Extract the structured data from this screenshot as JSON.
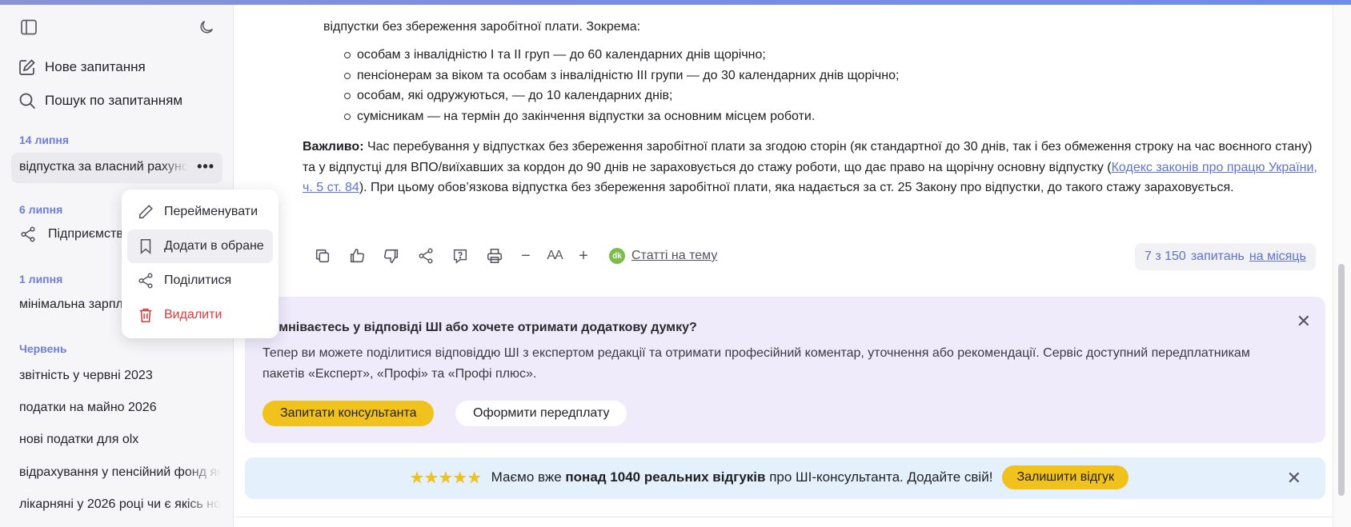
{
  "sidebar": {
    "new_request": "Нове запитання",
    "search": "Пошук по запитанням",
    "groups": [
      {
        "label": "14 липня",
        "items": [
          "відпустка за власний рахунок"
        ]
      },
      {
        "label": "6 липня",
        "items": [
          "Підприємство"
        ]
      },
      {
        "label": "1 липня",
        "items": [
          "мінімальна зарплата"
        ]
      },
      {
        "label": "Червень",
        "items": [
          "звітність у червні 2023",
          "податки на майно 2026",
          "нові податки для olx",
          "відрахування у пенсійний фонд як",
          "лікарняні у 2026 році чи є якісь но"
        ]
      }
    ],
    "more_glyph": "•••"
  },
  "context_menu": {
    "items": [
      {
        "label": "Перейменувати",
        "icon": "pencil-icon"
      },
      {
        "label": "Додати в обране",
        "icon": "bookmark-icon"
      },
      {
        "label": "Поділитися",
        "icon": "share-icon"
      },
      {
        "label": "Видалити",
        "icon": "trash-icon"
      }
    ]
  },
  "content": {
    "top_line": "відпустки без збереження заробітної плати. Зокрема:",
    "bullets": [
      "особам з інвалідністю I та II груп — до 60 календарних днів щорічно;",
      "пенсіонерам за віком та особам з інвалідністю III групи — до 30 календарних днів щорічно;",
      "особам, які одружуються, — до 10 календарних днів;",
      "сумісникам — на термін до закінчення відпустки за основним місцем роботи."
    ],
    "important_label": "Важливо:",
    "important_text": " Час перебування у відпустках без збереження заробітної плати за згодою сторін (як стандартної до 30 днів, так і без обмеження строку на час воєнного стану) та у відпустці для ВПО/виїхавших за кордон до 90 днів не зараховується до стажу роботи, що дає право на щорічну основну відпустку (",
    "important_link": "Кодекс законів про працю України, ч. 5 ст. 84",
    "important_tail": "). При цьому обов’язкова відпустка без збереження заробітної плати, яка надається за ст. 25 Закону про відпустки, до такого стажу зараховується."
  },
  "toolbar": {
    "icons": [
      "copy-icon",
      "thumbs-up-icon",
      "thumbs-down-icon",
      "share-icon",
      "help-icon",
      "print-icon",
      "font-decrease-icon",
      "font-size-icon",
      "font-increase-icon"
    ],
    "minus": "−",
    "aa": "AA",
    "plus": "+",
    "dk_badge": "dk",
    "articles": "Статті на тему",
    "quota_count": "7 з 150",
    "quota_text": "запитань",
    "quota_link": "на місяць"
  },
  "expert_banner": {
    "title": "Сумніваєтесь у відповіді ШІ або хочете отримати додаткову думку?",
    "description": "Тепер ви можете поділитися відповіддю ШІ з експертом редакції та отримати професійний коментар, уточнення або рекомендації. Сервіс доступний передплатникам пакетів «Експерт», «Профі» та «Профі плюс».",
    "ask_button": "Запитати консультанта",
    "subscribe_button": "Оформити передплату",
    "close": "✕"
  },
  "review_banner": {
    "stars": "★★★★★",
    "text_before": "Маємо вже ",
    "text_bold": "понад 1040 реальних відгуків",
    "text_after": " про ШІ-консультанта. Додайте свій!",
    "button": "Залишити відгук",
    "close": "✕"
  },
  "colors": {
    "accent": "#6d7ed8",
    "yellow": "#f2c21c",
    "danger": "#e0393c",
    "expert_bg": "#efebfb",
    "review_bg": "#e4f0fb"
  }
}
